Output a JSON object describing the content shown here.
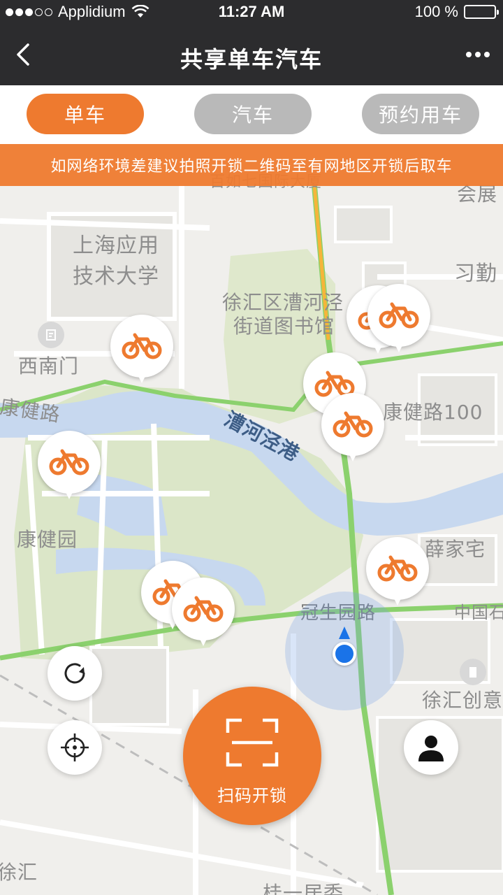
{
  "status_bar": {
    "carrier": "Applidium",
    "time": "11:27 AM",
    "battery": "100 %"
  },
  "nav": {
    "title": "共享单车汽车"
  },
  "tabs": [
    {
      "label": "单车",
      "active": true
    },
    {
      "label": "汽车",
      "active": false
    },
    {
      "label": "预约用车",
      "active": false
    }
  ],
  "notice": "如网络环境差建议拍照开锁二维码至有网地区开锁后取车",
  "map": {
    "labels": {
      "school": "上海应用\n技术大学",
      "school_line1": "上海应用",
      "school_line2": "技术大学",
      "library_line1": "徐汇区漕河泾",
      "library_line2": "街道图书馆",
      "west_gate": "西南门",
      "kangjian_road_left": "康健路",
      "river": "漕河泾港",
      "kangjian_road_100": "康健路100",
      "kangjian_park": "康健园",
      "xuejia": "薛家宅",
      "guansheng_road": "冠生园路",
      "china": "中国石",
      "xuhui_creative": "徐汇创意",
      "xijin": "习勤",
      "expo": "会展",
      "xuhui_bottom": "徐汇",
      "gui_bottom": "桂一居委",
      "top_partial": "百如七国际大厦"
    }
  },
  "actions": {
    "scan_label": "扫码开锁"
  },
  "colors": {
    "accent": "#ee7a2f",
    "header": "#2c2c2e",
    "inactive_tab": "#b9b9b9",
    "location": "#1a73e8"
  }
}
